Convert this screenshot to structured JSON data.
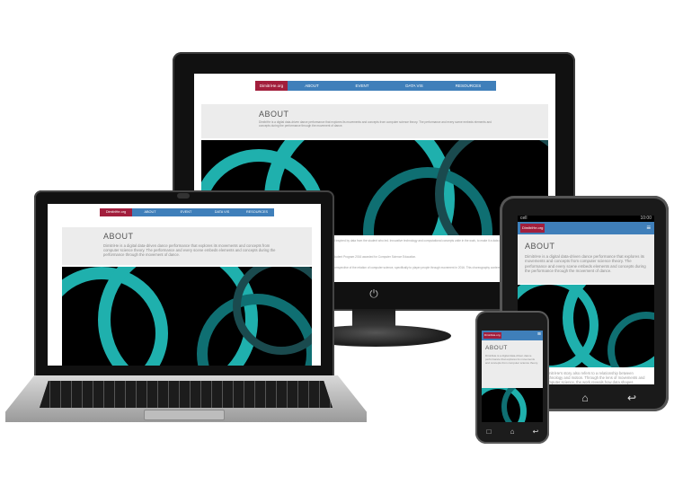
{
  "site": {
    "brand": "DimitriHe.org",
    "nav": [
      "ABOUT",
      "EVENT",
      "DATA VIS",
      "RESOURCES"
    ],
    "heading": "ABOUT",
    "intro": "DimitriHe is a digital data-driven dance performance that explores its movements and concepts from computer science theory. The performance and every scene embeds elements and concepts during the performance through the movement of dance.",
    "below_text_1": "brought in, influenced and inspired by data from the student who led. Innovative technology and computational concepts unite in the work, to make it a data driven live art experience for viewers and students.",
    "below_text_2": "program. Events for the Student Program 2016 awarded for Computer Science Education.",
    "below_text_3": "DimitriHe's story offers a perspective of the relation of computer science, specifically to player people through movement in 2016. This choreography contemplates computer science theory from the way it connects",
    "tablet_below": "DimitriHe's story also refers to a relationship between technology and motion. Through the lens of movements and computer science, the work reveals how data shapes performance and art.",
    "phone_intro": "DimitriHe is a digital data-driven dance performance that explores its movements and concepts from computer science theory."
  },
  "tablet": {
    "status_left": "cell",
    "status_right": "10:00"
  },
  "icons": {
    "power": "power-icon",
    "menu": "menu-icon",
    "home": "home-icon",
    "back": "back-icon",
    "recent": "recent-apps-icon"
  },
  "colors": {
    "brand": "#a21e3c",
    "nav": "#3f7fba",
    "art_ring": "#1fb0ad"
  }
}
